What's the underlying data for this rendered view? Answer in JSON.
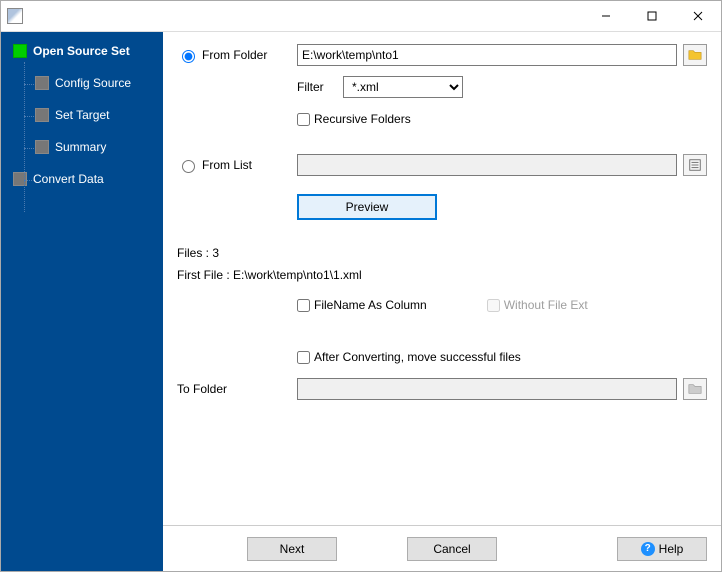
{
  "window": {
    "title": ""
  },
  "sidebar": {
    "items": [
      {
        "label": "Open Source Set"
      },
      {
        "label": "Config Source"
      },
      {
        "label": "Set Target"
      },
      {
        "label": "Summary"
      },
      {
        "label": "Convert Data"
      }
    ]
  },
  "main": {
    "fromFolder": {
      "radioLabel": "From Folder",
      "path": "E:\\work\\temp\\nto1",
      "filterLabel": "Filter",
      "filterValue": "*.xml",
      "recursiveLabel": "Recursive Folders"
    },
    "fromList": {
      "radioLabel": "From List",
      "path": ""
    },
    "previewLabel": "Preview",
    "filesCount": "Files : 3",
    "firstFile": "First File : E:\\work\\temp\\nto1\\1.xml",
    "filenameAsColumn": "FileName As Column",
    "withoutFileExt": "Without File Ext",
    "afterConvertMove": "After Converting, move successful files",
    "toFolderLabel": "To Folder",
    "toFolderPath": ""
  },
  "buttons": {
    "next": "Next",
    "cancel": "Cancel",
    "help": "Help"
  }
}
